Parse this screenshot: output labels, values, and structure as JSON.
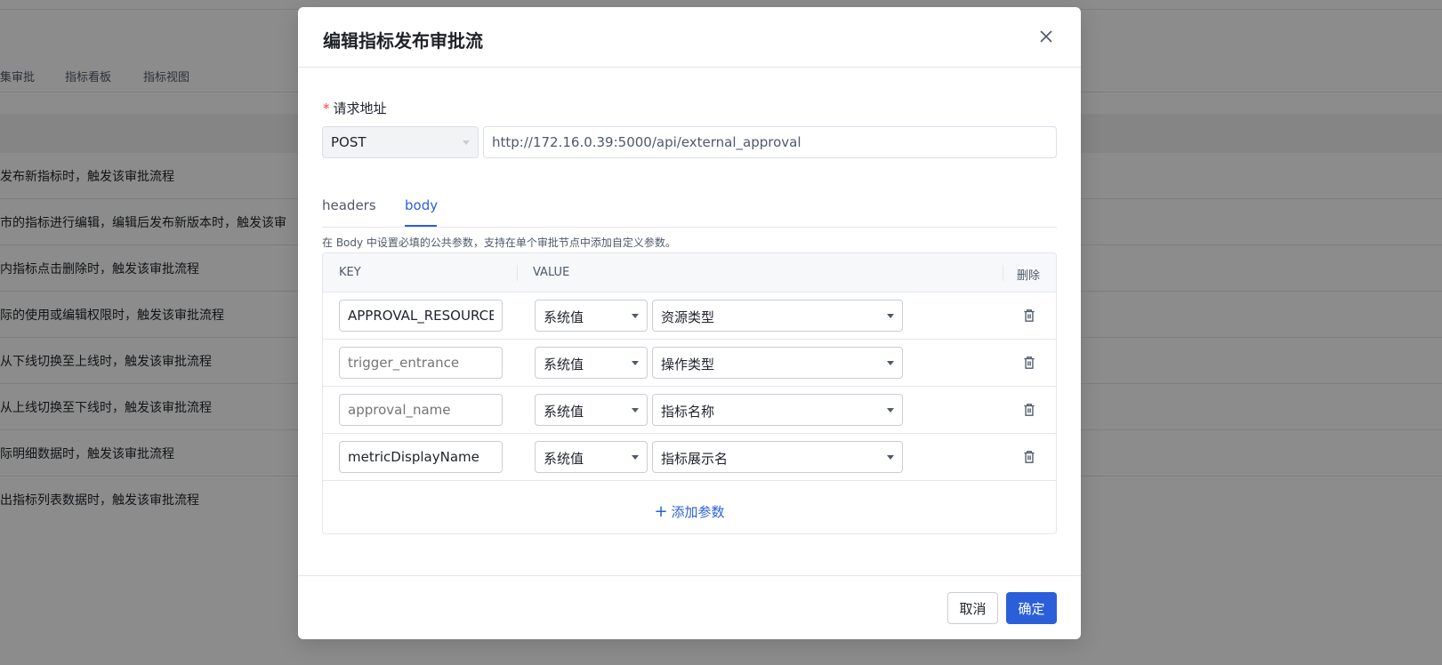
{
  "background": {
    "tabs": [
      "集审批",
      "指标看板",
      "指标视图"
    ],
    "rows": [
      "发布新指标时，触发该审批流程",
      "市的指标进行编辑，编辑后发布新版本时，触发该审",
      "内指标点击删除时，触发该审批流程",
      "际的使用或编辑权限时，触发该审批流程",
      "从下线切换至上线时，触发该审批流程",
      "从上线切换至下线时，触发该审批流程",
      "际明细数据时，触发该审批流程",
      "出指标列表数据时，触发该审批流程"
    ]
  },
  "modal": {
    "title": "编辑指标发布审批流",
    "close_icon": "close-icon",
    "request": {
      "required_mark": "*",
      "label": "请求地址",
      "method": "POST",
      "url": "http://172.16.0.39:5000/api/external_approval"
    },
    "tabs": [
      {
        "label": "headers",
        "active": false
      },
      {
        "label": "body",
        "active": true
      }
    ],
    "hint": "在 Body 中设置必填的公共参数，支持在单个审批节点中添加自定义参数。",
    "table": {
      "columns": {
        "key": "KEY",
        "value": "VALUE",
        "delete": "删除"
      },
      "rows": [
        {
          "key": "APPROVAL_RESOURCE_TYPE",
          "key_filled": true,
          "type": "系统值",
          "value": "资源类型"
        },
        {
          "key": "trigger_entrance",
          "key_filled": false,
          "type": "系统值",
          "value": "操作类型"
        },
        {
          "key": "approval_name",
          "key_filled": false,
          "type": "系统值",
          "value": "指标名称"
        },
        {
          "key": "metricDisplayName",
          "key_filled": true,
          "type": "系统值",
          "value": "指标展示名"
        }
      ],
      "add_label": "添加参数",
      "add_icon": "plus-icon",
      "delete_icon": "trash-icon"
    },
    "footer": {
      "cancel_label": "取消",
      "ok_label": "确定"
    },
    "colors": {
      "primary": "#2b5fd9",
      "required": "#f53f3f",
      "overlay": "rgba(0,0,0,0.45)"
    }
  }
}
